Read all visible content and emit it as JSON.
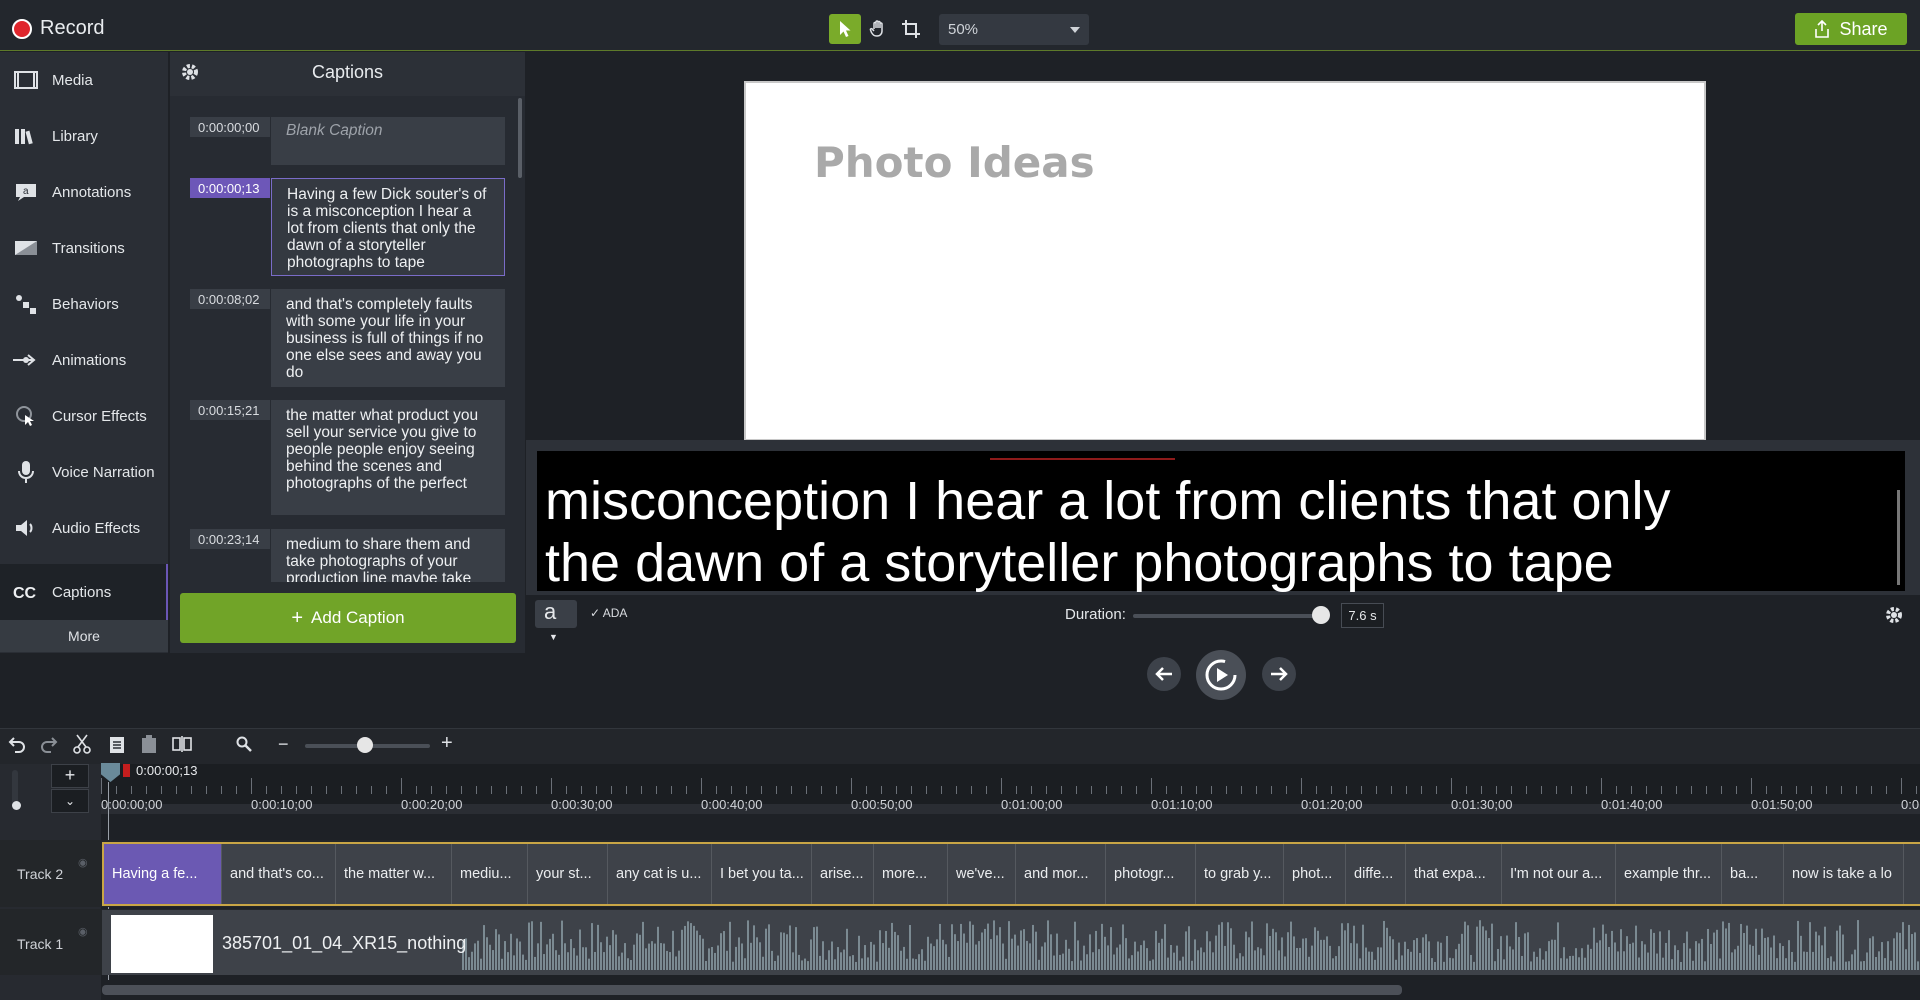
{
  "header": {
    "record_label": "Record",
    "zoom_value": "50%",
    "share_label": "Share"
  },
  "rail": {
    "items": [
      {
        "label": "Media",
        "icon": "film-icon"
      },
      {
        "label": "Library",
        "icon": "library-icon"
      },
      {
        "label": "Annotations",
        "icon": "annotation-icon"
      },
      {
        "label": "Transitions",
        "icon": "transition-icon"
      },
      {
        "label": "Behaviors",
        "icon": "behaviors-icon"
      },
      {
        "label": "Animations",
        "icon": "animation-arrow-icon"
      },
      {
        "label": "Cursor Effects",
        "icon": "cursor-icon"
      },
      {
        "label": "Voice Narration",
        "icon": "microphone-icon"
      },
      {
        "label": "Audio Effects",
        "icon": "speaker-icon"
      },
      {
        "label": "Captions",
        "icon": "cc-icon"
      }
    ],
    "more_label": "More"
  },
  "captions_panel": {
    "title": "Captions",
    "entries": [
      {
        "time": "0:00:00;00",
        "text": "Blank Caption"
      },
      {
        "time": "0:00:00;13",
        "text": "Having a few Dick souter's of is a misconception I hear a lot from clients that only the dawn of a storyteller photographs to tape"
      },
      {
        "time": "0:00:08;02",
        "text": "and that's completely faults with some your life in your business is full of things if no one else sees and away you do"
      },
      {
        "time": "0:00:15;21",
        "text": "the matter what product you sell your service you give to people people enjoy seeing behind the scenes and photographs of the perfect"
      },
      {
        "time": "0:00:23;14",
        "text": "medium to share them and take photographs of your production line maybe take"
      }
    ],
    "add_label": "Add Caption"
  },
  "canvas": {
    "slide_title": "Photo Ideas",
    "caption_line1": "misconception I hear a lot from clients that only",
    "caption_line2": "the dawn of a storyteller photographs to tape",
    "font_glyph": "a",
    "ada_label": "ADA",
    "duration_label": "Duration:",
    "duration_value": "7.6 s"
  },
  "timeline": {
    "playhead_time": "0:00:00;13",
    "ruler_labels": [
      "0:00:00;00",
      "0:00:10;00",
      "0:00:20;00",
      "0:00:30;00",
      "0:00:40;00",
      "0:00:50;00",
      "0:01:00;00",
      "0:01:10;00",
      "0:01:20;00",
      "0:01:30;00",
      "0:01:40;00",
      "0:01:50;00",
      "0:0"
    ],
    "track2_label": "Track 2",
    "track1_label": "Track 1",
    "track2_clips": [
      "Having a fe...",
      "and that's co...",
      "the matter w...",
      "mediu...",
      "your st...",
      "any cat is u...",
      "I bet you ta...",
      "arise...",
      "more...",
      "we've...",
      "and mor...",
      "photogr...",
      "to grab y...",
      "phot...",
      "diffe...",
      "that expa...",
      "I'm not our a...",
      "example thr...",
      "ba...",
      "now is take a lo"
    ],
    "track1_clip_name": "385701_01_04_XR15_nothing"
  },
  "colors": {
    "accent_green": "#71a428",
    "accent_purple": "#6b59b3",
    "record_red": "#e0262d"
  }
}
